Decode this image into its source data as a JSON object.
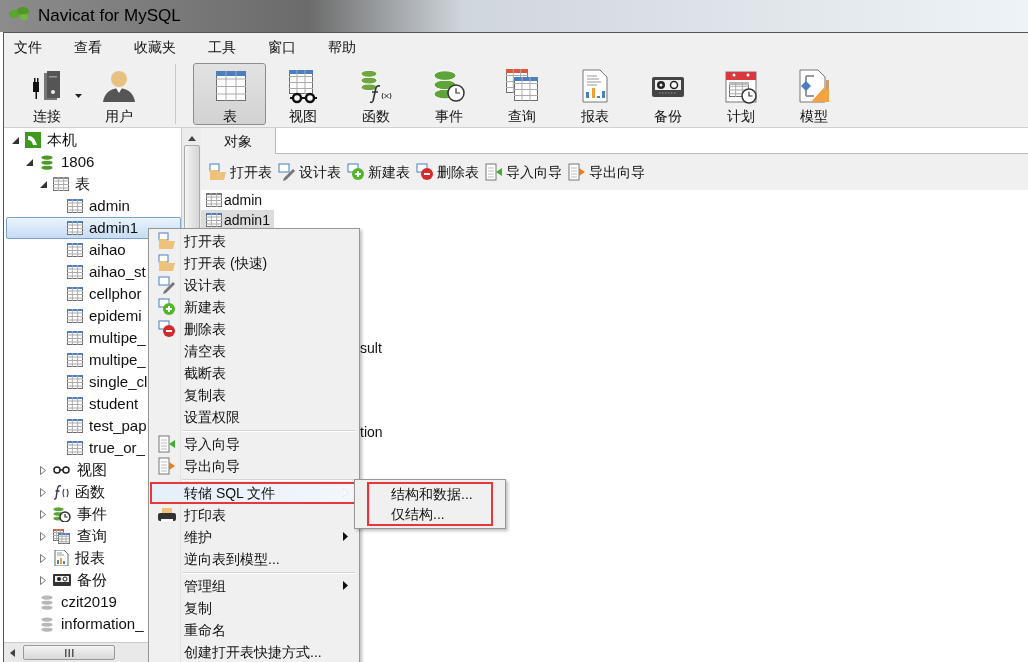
{
  "window": {
    "title": "Navicat for MySQL"
  },
  "menu_bar": [
    "文件",
    "查看",
    "收藏夹",
    "工具",
    "窗口",
    "帮助"
  ],
  "toolbar": [
    {
      "label": "连接",
      "kind": "connect",
      "selected": false,
      "dropdown": true
    },
    {
      "label": "用户",
      "kind": "user",
      "selected": false,
      "dropdown": false
    },
    {
      "label": "表",
      "kind": "table",
      "selected": true,
      "dropdown": false
    },
    {
      "label": "视图",
      "kind": "view",
      "selected": false,
      "dropdown": false
    },
    {
      "label": "函数",
      "kind": "function",
      "selected": false,
      "dropdown": false
    },
    {
      "label": "事件",
      "kind": "event",
      "selected": false,
      "dropdown": false
    },
    {
      "label": "查询",
      "kind": "query",
      "selected": false,
      "dropdown": false
    },
    {
      "label": "报表",
      "kind": "report",
      "selected": false,
      "dropdown": false
    },
    {
      "label": "备份",
      "kind": "backup",
      "selected": false,
      "dropdown": false
    },
    {
      "label": "计划",
      "kind": "schedule",
      "selected": false,
      "dropdown": false
    },
    {
      "label": "模型",
      "kind": "model",
      "selected": false,
      "dropdown": false
    }
  ],
  "tree": [
    {
      "label": "本机",
      "kind": "connection",
      "expanded": true,
      "selected": false,
      "children": [
        {
          "label": "1806",
          "kind": "database",
          "expanded": true,
          "selected": false,
          "children": [
            {
              "label": "表",
              "kind": "tables",
              "expanded": true,
              "selected": false,
              "children": [
                {
                  "label": "admin",
                  "kind": "table",
                  "selected": false
                },
                {
                  "label": "admin1",
                  "kind": "table",
                  "selected": true
                },
                {
                  "label": "aihao",
                  "kind": "table",
                  "selected": false
                },
                {
                  "label": "aihao_st",
                  "kind": "table",
                  "selected": false
                },
                {
                  "label": "cellphor",
                  "kind": "table",
                  "selected": false
                },
                {
                  "label": "epidemi",
                  "kind": "table",
                  "selected": false
                },
                {
                  "label": "multipe_",
                  "kind": "table",
                  "selected": false
                },
                {
                  "label": "multipe_",
                  "kind": "table",
                  "selected": false
                },
                {
                  "label": "single_cl",
                  "kind": "table",
                  "selected": false
                },
                {
                  "label": "student",
                  "kind": "table",
                  "selected": false
                },
                {
                  "label": "test_pap",
                  "kind": "table",
                  "selected": false
                },
                {
                  "label": "true_or_",
                  "kind": "table",
                  "selected": false
                }
              ]
            },
            {
              "label": "视图",
              "kind": "views",
              "expanded": false,
              "selected": false
            },
            {
              "label": "函数",
              "kind": "functions",
              "expanded": false,
              "selected": false
            },
            {
              "label": "事件",
              "kind": "events",
              "expanded": false,
              "selected": false
            },
            {
              "label": "查询",
              "kind": "queries",
              "expanded": false,
              "selected": false
            },
            {
              "label": "报表",
              "kind": "reports",
              "expanded": false,
              "selected": false
            },
            {
              "label": "备份",
              "kind": "backups",
              "expanded": false,
              "selected": false
            }
          ]
        },
        {
          "label": "czit2019",
          "kind": "database",
          "selected": false
        },
        {
          "label": "information_",
          "kind": "database",
          "selected": false
        }
      ]
    }
  ],
  "tabs": [
    {
      "label": "对象",
      "selected": true
    }
  ],
  "object_toolbar": [
    {
      "label": "打开表",
      "kind": "open"
    },
    {
      "label": "设计表",
      "kind": "design"
    },
    {
      "label": "新建表",
      "kind": "new"
    },
    {
      "label": "删除表",
      "kind": "delete"
    },
    {
      "label": "导入向导",
      "kind": "import"
    },
    {
      "label": "导出向导",
      "kind": "export"
    }
  ],
  "objects": [
    {
      "name": "admin",
      "covered": false,
      "selected": false
    },
    {
      "name": "admin1",
      "covered": false,
      "selected": true
    },
    {
      "name": "sult",
      "covered": true,
      "selected": false
    },
    {
      "name": "tion",
      "covered": true,
      "selected": false
    }
  ],
  "context_menu": {
    "items": [
      {
        "kind": "item",
        "label": "打开表",
        "selected": false,
        "submenu": false,
        "annotated": false
      },
      {
        "kind": "item",
        "label": "打开表 (快速)",
        "selected": false,
        "submenu": false,
        "annotated": false
      },
      {
        "kind": "item",
        "label": "设计表",
        "selected": false,
        "submenu": false,
        "annotated": false
      },
      {
        "kind": "item",
        "label": "新建表",
        "selected": false,
        "submenu": false,
        "annotated": false
      },
      {
        "kind": "item",
        "label": "删除表",
        "selected": false,
        "submenu": false,
        "annotated": false
      },
      {
        "kind": "item",
        "label": "清空表",
        "selected": false,
        "submenu": false,
        "annotated": false
      },
      {
        "kind": "item",
        "label": "截断表",
        "selected": false,
        "submenu": false,
        "annotated": false
      },
      {
        "kind": "item",
        "label": "复制表",
        "selected": false,
        "submenu": false,
        "annotated": false
      },
      {
        "kind": "item",
        "label": "设置权限",
        "selected": false,
        "submenu": false,
        "annotated": false
      },
      {
        "kind": "separator"
      },
      {
        "kind": "item",
        "label": "导入向导",
        "selected": false,
        "submenu": false,
        "annotated": false
      },
      {
        "kind": "item",
        "label": "导出向导",
        "selected": false,
        "submenu": false,
        "annotated": false
      },
      {
        "kind": "separator"
      },
      {
        "kind": "item",
        "label": "转储 SQL 文件",
        "selected": true,
        "submenu": true,
        "annotated": true
      },
      {
        "kind": "item",
        "label": "打印表",
        "selected": false,
        "submenu": false,
        "annotated": false
      },
      {
        "kind": "item",
        "label": "维护",
        "selected": false,
        "submenu": true,
        "annotated": false
      },
      {
        "kind": "item",
        "label": "逆向表到模型...",
        "selected": false,
        "submenu": false,
        "annotated": false
      },
      {
        "kind": "separator"
      },
      {
        "kind": "item",
        "label": "管理组",
        "selected": false,
        "submenu": true,
        "annotated": false
      },
      {
        "kind": "item",
        "label": "复制",
        "selected": false,
        "submenu": false,
        "annotated": false
      },
      {
        "kind": "item",
        "label": "重命名",
        "selected": false,
        "submenu": false,
        "annotated": false
      },
      {
        "kind": "item",
        "label": "创建打开表快捷方式...",
        "selected": false,
        "submenu": false,
        "annotated": false
      }
    ]
  },
  "submenu": {
    "annotated": true,
    "items": [
      {
        "label": "结构和数据...",
        "selected": false
      },
      {
        "label": "仅结构...",
        "selected": false
      }
    ]
  }
}
